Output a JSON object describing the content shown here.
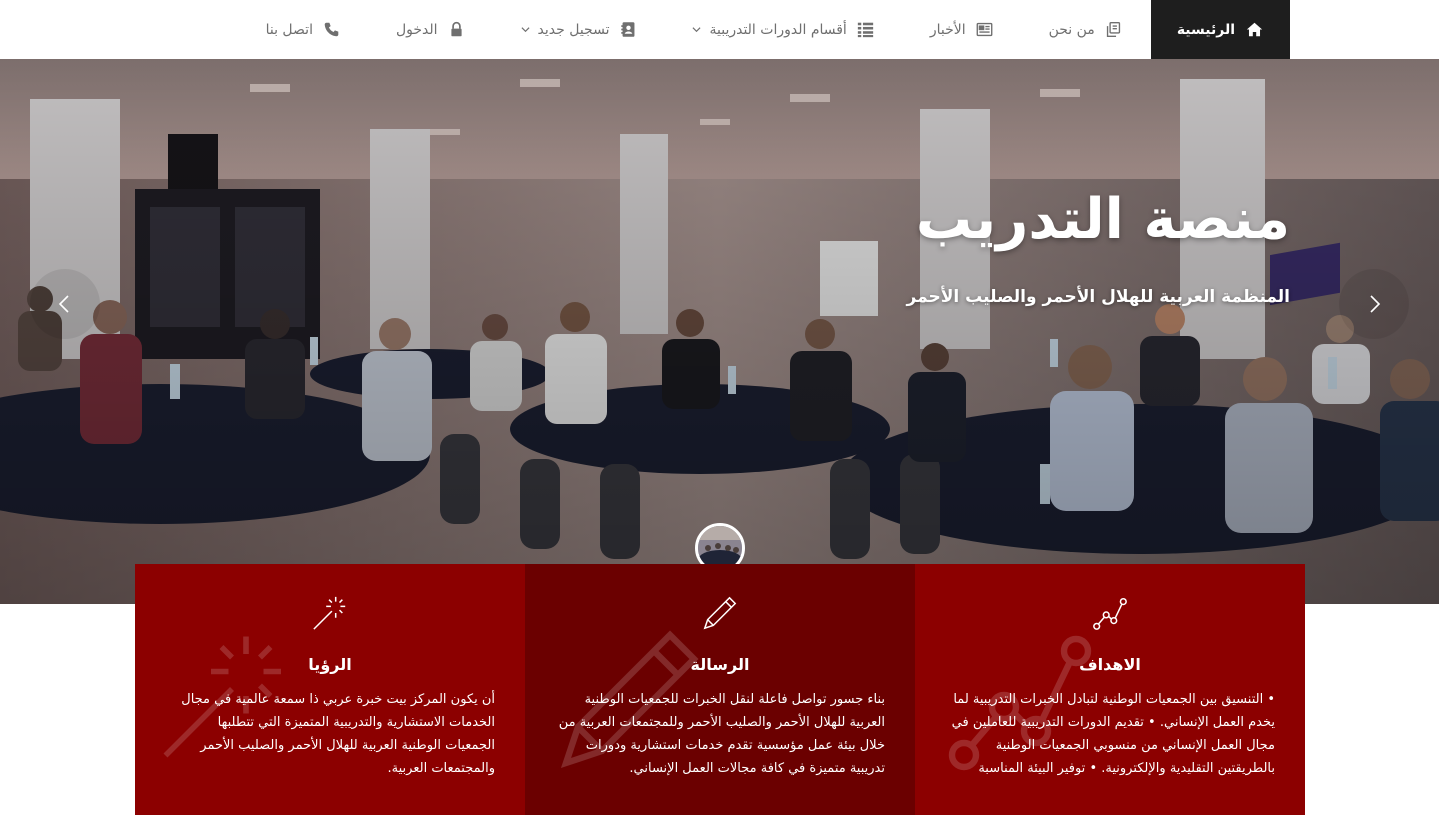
{
  "nav": {
    "items": [
      {
        "label": "الرئيسية",
        "icon": "home-icon",
        "active": true
      },
      {
        "label": "من نحن",
        "icon": "copy-icon",
        "active": false
      },
      {
        "label": "الأخبار",
        "icon": "newspaper-icon",
        "active": false
      },
      {
        "label": "أقسام الدورات التدريبية",
        "icon": "list-icon",
        "active": false,
        "dropdown": true
      },
      {
        "label": "تسجيل جديد",
        "icon": "contact-card-icon",
        "active": false,
        "dropdown": true
      },
      {
        "label": "الدخول",
        "icon": "lock-icon",
        "active": false
      },
      {
        "label": "اتصل بنا",
        "icon": "phone-icon",
        "active": false
      }
    ]
  },
  "hero": {
    "title": "منصة التدريب",
    "subtitle": "المنظمة العربية للهلال الأحمر والصليب الأحمر"
  },
  "features": [
    {
      "title": "الرؤيا",
      "icon": "magic-wand-icon",
      "text": "أن يكون المركز بيت خبرة عربي ذا سمعة عالمية في مجال الخدمات الاستشارية والتدريبية المتميزة التي تتطلبها الجمعيات الوطنية العربية للهلال الأحمر والصليب الأحمر والمجتمعات العربية."
    },
    {
      "title": "الرسالة",
      "icon": "pencil-icon",
      "text": "بناء جسور تواصل فاعلة لنقل الخبرات للجمعيات الوطنية العربية للهلال الأحمر والصليب الأحمر وللمجتمعات العربية من خلال بيئة عمل مؤسسية تقدم خدمات استشارية ودورات تدريبية متميزة في كافة مجالات العمل الإنساني."
    },
    {
      "title": "الاهداف",
      "icon": "graph-icon",
      "text": "• التنسيق بين الجمعيات الوطنية لتبادل الخبرات التدريبية لما يخدم العمل الإنساني. • تقديم الدورات التدريبية للعاملين في مجال العمل الإنساني من منسوبي الجمعيات الوطنية بالطريقتين التقليدية والإلكترونية. • توفير البيئة المناسبة للتدريب والتأهيل."
    }
  ],
  "colors": {
    "nav_active_bg": "#1e1e1e",
    "nav_text": "#6f6f6f",
    "feature_red": "#8c0000",
    "feature_dark": "#6b0000"
  }
}
